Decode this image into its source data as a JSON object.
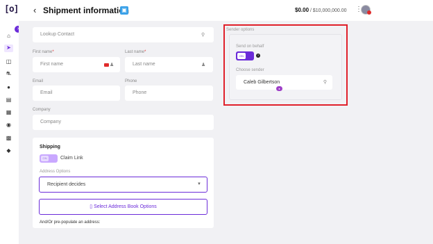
{
  "header": {
    "logo": "[o]",
    "back_icon": "‹",
    "title": "Shipment information",
    "balance_current": "$0.00",
    "balance_separator": " / ",
    "balance_limit": "$10,000,000.00"
  },
  "sidebar": {
    "items": [
      "home-icon",
      "send-icon",
      "inventory-icon",
      "truck-icon",
      "campaign-icon",
      "clipboard-icon",
      "grid-icon",
      "target-icon",
      "gift-card-icon",
      "shield-icon"
    ]
  },
  "form": {
    "lookup_placeholder": "Lookup Contact",
    "first_name_label": "First name",
    "first_name_placeholder": "First name",
    "last_name_label": "Last name",
    "last_name_placeholder": "Last name",
    "email_label": "Email",
    "email_placeholder": "Email",
    "phone_label": "Phone",
    "phone_placeholder": "Phone",
    "company_label": "Company",
    "company_placeholder": "Company",
    "required_mark": "*"
  },
  "shipping": {
    "title": "Shipping",
    "claim_toggle_state": "ON",
    "claim_label": "Claim Link",
    "address_options_label": "Address Options",
    "address_option_selected": "Recipient decides",
    "address_book_button": "Select Address Book Options",
    "prepopulate_label": "And/Or pre-populate an address:"
  },
  "sender": {
    "title": "Sender options",
    "send_on_behalf_label": "Send on behalf",
    "send_on_behalf_state": "ON",
    "choose_sender_label": "Choose sender",
    "sender_value": "Caleb Gilbertson"
  },
  "colors": {
    "accent": "#6b2bd9",
    "highlight_border": "#e0202a",
    "background": "#f1f1f4"
  }
}
